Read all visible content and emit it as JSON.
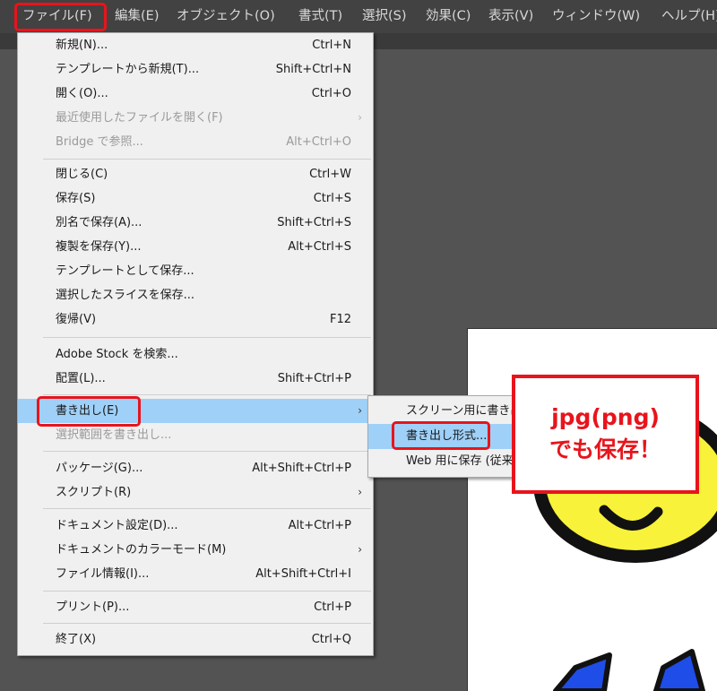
{
  "menubar": {
    "items": [
      {
        "label": "ファイル(F)"
      },
      {
        "label": "編集(E)"
      },
      {
        "label": "オブジェクト(O)"
      },
      {
        "label": "書式(T)"
      },
      {
        "label": "選択(S)"
      },
      {
        "label": "効果(C)"
      },
      {
        "label": "表示(V)"
      },
      {
        "label": "ウィンドウ(W)"
      },
      {
        "label": "ヘルプ(H)"
      }
    ]
  },
  "file_menu": {
    "items": [
      {
        "label": "新規(N)...",
        "shortcut": "Ctrl+N"
      },
      {
        "label": "テンプレートから新規(T)...",
        "shortcut": "Shift+Ctrl+N"
      },
      {
        "label": "開く(O)...",
        "shortcut": "Ctrl+O"
      },
      {
        "label": "最近使用したファイルを開く(F)",
        "shortcut": "",
        "submenu": true,
        "disabled": true
      },
      {
        "label": "Bridge で参照...",
        "shortcut": "Alt+Ctrl+O",
        "disabled": true
      },
      {
        "label": "閉じる(C)",
        "shortcut": "Ctrl+W"
      },
      {
        "label": "保存(S)",
        "shortcut": "Ctrl+S"
      },
      {
        "label": "別名で保存(A)...",
        "shortcut": "Shift+Ctrl+S"
      },
      {
        "label": "複製を保存(Y)...",
        "shortcut": "Alt+Ctrl+S"
      },
      {
        "label": "テンプレートとして保存...",
        "shortcut": ""
      },
      {
        "label": "選択したスライスを保存...",
        "shortcut": ""
      },
      {
        "label": "復帰(V)",
        "shortcut": "F12"
      },
      {
        "label": "Adobe Stock を検索...",
        "shortcut": ""
      },
      {
        "label": "配置(L)...",
        "shortcut": "Shift+Ctrl+P"
      },
      {
        "label": "書き出し(E)",
        "shortcut": "",
        "submenu": true,
        "active": true
      },
      {
        "label": "選択範囲を書き出し...",
        "shortcut": "",
        "disabled": true
      },
      {
        "label": "パッケージ(G)...",
        "shortcut": "Alt+Shift+Ctrl+P"
      },
      {
        "label": "スクリプト(R)",
        "shortcut": "",
        "submenu": true
      },
      {
        "label": "ドキュメント設定(D)...",
        "shortcut": "Alt+Ctrl+P"
      },
      {
        "label": "ドキュメントのカラーモード(M)",
        "shortcut": "",
        "submenu": true
      },
      {
        "label": "ファイル情報(I)...",
        "shortcut": "Alt+Shift+Ctrl+I"
      },
      {
        "label": "プリント(P)...",
        "shortcut": "Ctrl+P"
      },
      {
        "label": "終了(X)",
        "shortcut": "Ctrl+Q"
      }
    ],
    "submenu_arrow": "›"
  },
  "export_submenu": {
    "items": [
      {
        "label": "スクリーン用に書き出し..."
      },
      {
        "label": "書き出し形式..."
      },
      {
        "label": "Web 用に保存 (従来)..."
      }
    ]
  },
  "callout": {
    "line1": "jpg(png)",
    "line2": "でも保存！"
  },
  "colors": {
    "menubar_bg": "#424242",
    "menu_bg": "#f0f0f0",
    "highlight": "#9fd0f8",
    "annotation_red": "#e8141c",
    "face_yellow": "#f8f23a",
    "bow_blue": "#1f4de8"
  },
  "icons": [
    "chevron-right-icon"
  ]
}
